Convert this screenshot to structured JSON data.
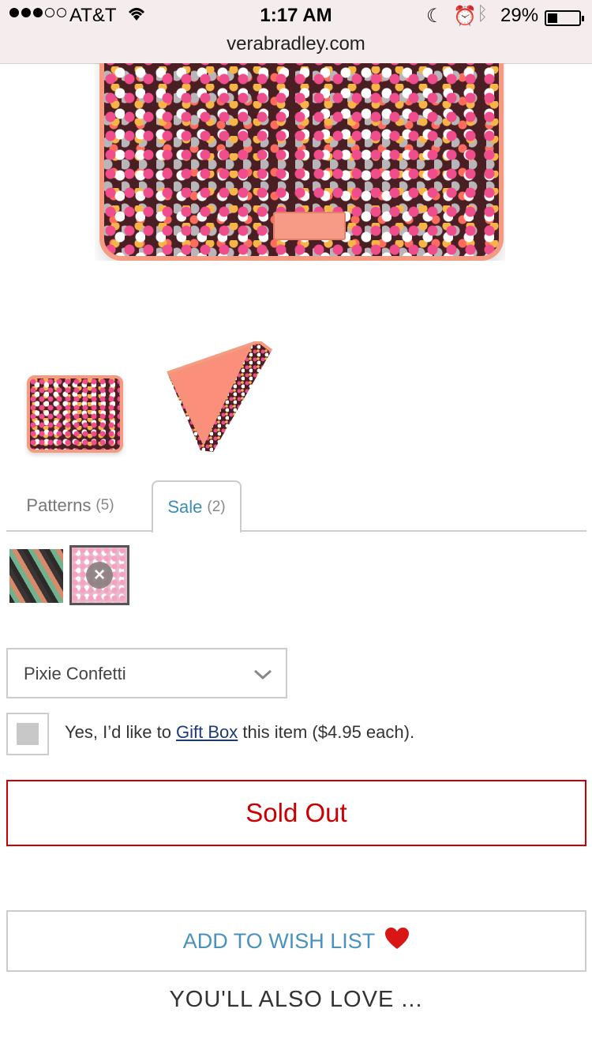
{
  "status_bar": {
    "carrier": "AT&T",
    "time": "1:17 AM",
    "battery": "29%",
    "url": "verabradley.com"
  },
  "tabs": [
    {
      "label": "Patterns",
      "count": "(5)"
    },
    {
      "label": "Sale",
      "count": "(2)"
    }
  ],
  "pattern_select": {
    "value": "Pixie Confetti"
  },
  "gift": {
    "prefix": "Yes, I’d like to ",
    "link": "Gift Box",
    "suffix": " this item ($4.95 each)."
  },
  "buttons": {
    "sold_out": "Sold Out",
    "wish_list": "ADD TO WISH LIST"
  },
  "section": {
    "also_love": "YOU'LL ALSO LOVE ..."
  },
  "colors": {
    "accent_red": "#cc0000",
    "link_blue": "#4a92be",
    "tab_active": "#3d8db5"
  }
}
